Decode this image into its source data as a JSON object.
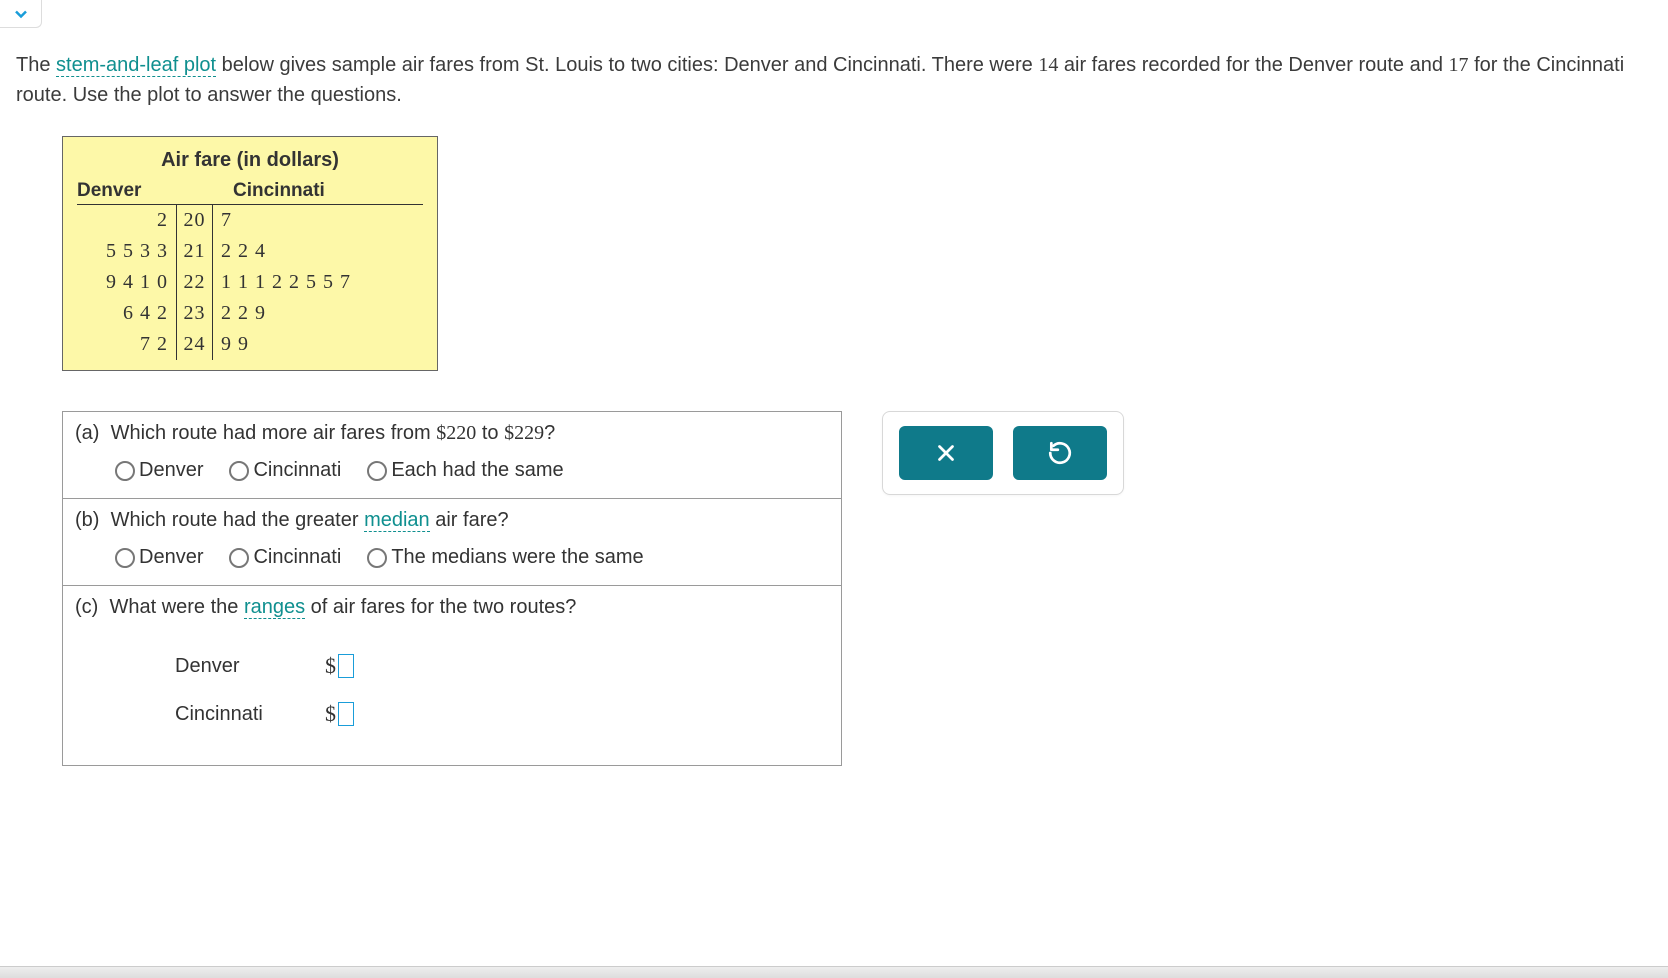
{
  "intro": {
    "pre": "The ",
    "link": "stem-and-leaf plot",
    "mid1": " below gives sample air fares from St. Louis to two cities: Denver and Cincinnati. There were ",
    "n1": "14",
    "mid2": " air fares recorded for the Denver route and ",
    "n2": "17",
    "post": " for the Cincinnati route. Use the plot to answer the questions."
  },
  "stemleaf": {
    "title": "Air fare (in dollars)",
    "left_header": "Denver",
    "right_header": "Cincinnati",
    "rows": [
      {
        "left": "2",
        "stem": "20",
        "right": "7"
      },
      {
        "left": "5 5 3 3",
        "stem": "21",
        "right": "2 2 4"
      },
      {
        "left": "9 4 1 0",
        "stem": "22",
        "right": "1 1 1 2 2 5 5 7"
      },
      {
        "left": "6 4 2",
        "stem": "23",
        "right": "2 2 9"
      },
      {
        "left": "7 2",
        "stem": "24",
        "right": "9 9"
      }
    ]
  },
  "questions": {
    "a": {
      "label": "(a)",
      "text_pre": "Which route had more air fares from ",
      "v1": "$220",
      "text_mid": " to ",
      "v2": "$229",
      "text_post": "?",
      "opts": [
        "Denver",
        "Cincinnati",
        "Each had the same"
      ]
    },
    "b": {
      "label": "(b)",
      "text_pre": "Which route had the greater ",
      "link": "median",
      "text_post": " air fare?",
      "opts": [
        "Denver",
        "Cincinnati",
        "The medians were the same"
      ]
    },
    "c": {
      "label": "(c)",
      "text_pre": "What were the ",
      "link": "ranges",
      "text_post": " of air fares for the two routes?",
      "rows": [
        {
          "label": "Denver",
          "currency": "$"
        },
        {
          "label": "Cincinnati",
          "currency": "$"
        }
      ]
    }
  },
  "actions": {
    "close": "close",
    "reset": "reset"
  }
}
